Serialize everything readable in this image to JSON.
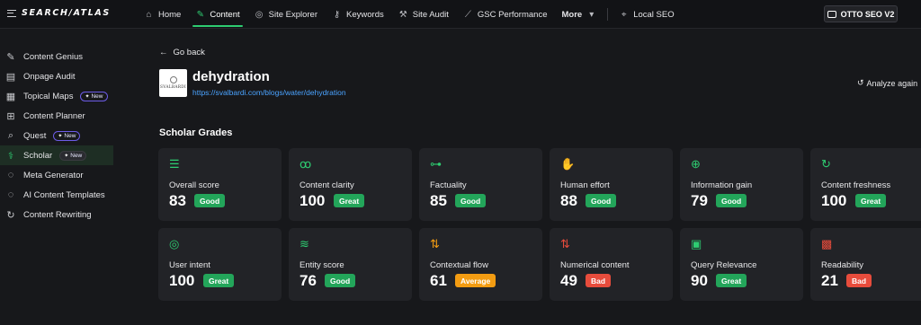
{
  "brand": {
    "logo_text": "SEARCH/ATLAS"
  },
  "nav": {
    "items": [
      {
        "label": "Home",
        "icon": "home-icon",
        "glyph": "⌂",
        "active": false
      },
      {
        "label": "Content",
        "icon": "pen-icon",
        "glyph": "✎",
        "active": true
      },
      {
        "label": "Site Explorer",
        "icon": "globe-search-icon",
        "glyph": "◎",
        "active": false
      },
      {
        "label": "Keywords",
        "icon": "key-icon",
        "glyph": "⚷",
        "active": false
      },
      {
        "label": "Site Audit",
        "icon": "wrench-icon",
        "glyph": "⚒",
        "active": false
      },
      {
        "label": "GSC Performance",
        "icon": "chart-icon",
        "glyph": "⟋",
        "active": false
      },
      {
        "label": "More",
        "icon": "chevron-down-icon",
        "glyph": "▾",
        "active": false
      },
      {
        "label": "Local SEO",
        "icon": "map-pin-icon",
        "glyph": "⌖",
        "active": false
      }
    ],
    "otto_label": "OTTO SEO V2"
  },
  "sidebar": {
    "items": [
      {
        "label": "Content Genius",
        "icon": "edit-icon",
        "glyph": "✎",
        "badge": ""
      },
      {
        "label": "Onpage Audit",
        "icon": "document-icon",
        "glyph": "▤",
        "badge": ""
      },
      {
        "label": "Topical Maps",
        "icon": "grid-icon",
        "glyph": "▦",
        "badge": "New"
      },
      {
        "label": "Content Planner",
        "icon": "planner-icon",
        "glyph": "⊞",
        "badge": ""
      },
      {
        "label": "Quest",
        "icon": "search-icon",
        "glyph": "⌕",
        "badge": "New"
      },
      {
        "label": "Scholar",
        "icon": "scholar-icon",
        "glyph": "⚕",
        "badge": "New",
        "active": true
      },
      {
        "label": "Meta Generator",
        "icon": "bulb-icon",
        "glyph": "◌",
        "badge": ""
      },
      {
        "label": "AI Content Templates",
        "icon": "bulb-icon",
        "glyph": "◌",
        "badge": ""
      },
      {
        "label": "Content Rewriting",
        "icon": "refresh-icon",
        "glyph": "↻",
        "badge": ""
      }
    ]
  },
  "page": {
    "back_label": "Go back",
    "thumb_text": "SVALBARDI",
    "title": "dehydration",
    "url": "https://svalbardi.com/blogs/water/dehydration",
    "analyze_label": "Analyze again",
    "section_title": "Scholar Grades"
  },
  "grades": [
    {
      "label": "Overall score",
      "value": "83",
      "grade": "Good",
      "icon": "list-icon",
      "glyph": "☰",
      "color": "#2ecc71"
    },
    {
      "label": "Content clarity",
      "value": "100",
      "grade": "Great",
      "icon": "glasses-icon",
      "glyph": "ꝏ",
      "color": "#2ecc71"
    },
    {
      "label": "Factuality",
      "value": "85",
      "grade": "Good",
      "icon": "nodes-icon",
      "glyph": "⊶",
      "color": "#2ecc71"
    },
    {
      "label": "Human effort",
      "value": "88",
      "grade": "Good",
      "icon": "hand-icon",
      "glyph": "✋",
      "color": "#2ecc71"
    },
    {
      "label": "Information gain",
      "value": "79",
      "grade": "Good",
      "icon": "zoom-in-icon",
      "glyph": "⊕",
      "color": "#2ecc71"
    },
    {
      "label": "Content freshness",
      "value": "100",
      "grade": "Great",
      "icon": "refresh-icon",
      "glyph": "↻",
      "color": "#2ecc71"
    },
    {
      "label": "User intent",
      "value": "100",
      "grade": "Great",
      "icon": "target-icon",
      "glyph": "◎",
      "color": "#2ecc71"
    },
    {
      "label": "Entity score",
      "value": "76",
      "grade": "Good",
      "icon": "layers-icon",
      "glyph": "≋",
      "color": "#2ecc71"
    },
    {
      "label": "Contextual flow",
      "value": "61",
      "grade": "Average",
      "icon": "flow-icon",
      "glyph": "⇅",
      "color": "#f39c12"
    },
    {
      "label": "Numerical content",
      "value": "49",
      "grade": "Bad",
      "icon": "sort-numeric-icon",
      "glyph": "⇅",
      "color": "#e74c3c"
    },
    {
      "label": "Query Relevance",
      "value": "90",
      "grade": "Great",
      "icon": "file-search-icon",
      "glyph": "▣",
      "color": "#2ecc71"
    },
    {
      "label": "Readability",
      "value": "21",
      "grade": "Bad",
      "icon": "box-icon",
      "glyph": "▩",
      "color": "#e74c3c"
    }
  ]
}
